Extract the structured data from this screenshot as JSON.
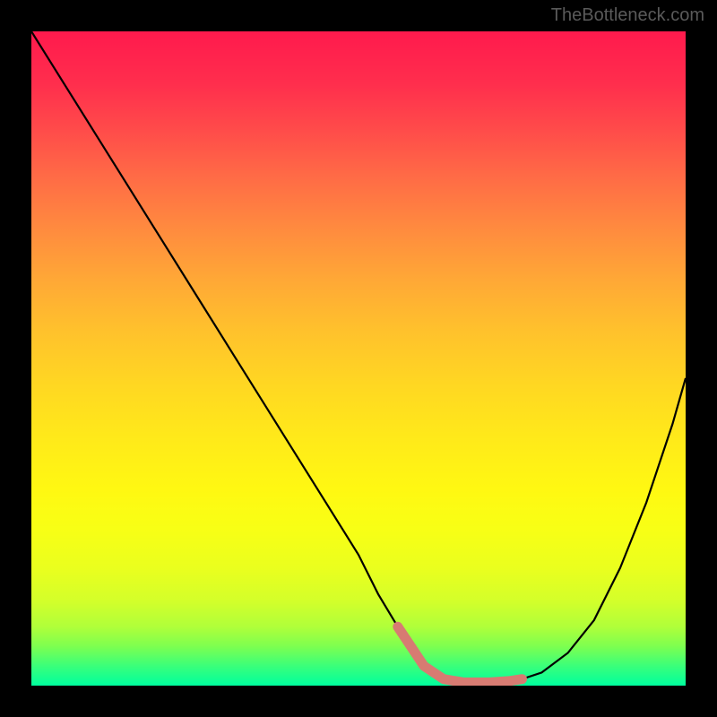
{
  "watermark": "TheBottleneck.com",
  "chart_data": {
    "type": "line",
    "title": "",
    "xlabel": "",
    "ylabel": "",
    "xlim": [
      0,
      100
    ],
    "ylim": [
      0,
      100
    ],
    "grid": false,
    "legend": false,
    "series": [
      {
        "name": "curve",
        "color": "#000000",
        "x": [
          0,
          5,
          10,
          15,
          20,
          25,
          30,
          35,
          40,
          45,
          50,
          53,
          56,
          58,
          60,
          63,
          66,
          70,
          73,
          75,
          78,
          82,
          86,
          90,
          94,
          98,
          100
        ],
        "values": [
          100,
          92,
          84,
          76,
          68,
          60,
          52,
          44,
          36,
          28,
          20,
          14,
          9,
          6,
          3,
          1,
          0.5,
          0.5,
          0.7,
          1,
          2,
          5,
          10,
          18,
          28,
          40,
          47
        ]
      },
      {
        "name": "highlight",
        "color": "#d77b72",
        "x": [
          56,
          58,
          60,
          63,
          66,
          70,
          73,
          75
        ],
        "values": [
          9,
          6,
          3,
          1,
          0.5,
          0.5,
          0.7,
          1
        ]
      }
    ],
    "gradient_stops": [
      {
        "pos": 0,
        "color": "#ff1a4d"
      },
      {
        "pos": 50,
        "color": "#ffd722"
      },
      {
        "pos": 100,
        "color": "#00ff9e"
      }
    ]
  }
}
